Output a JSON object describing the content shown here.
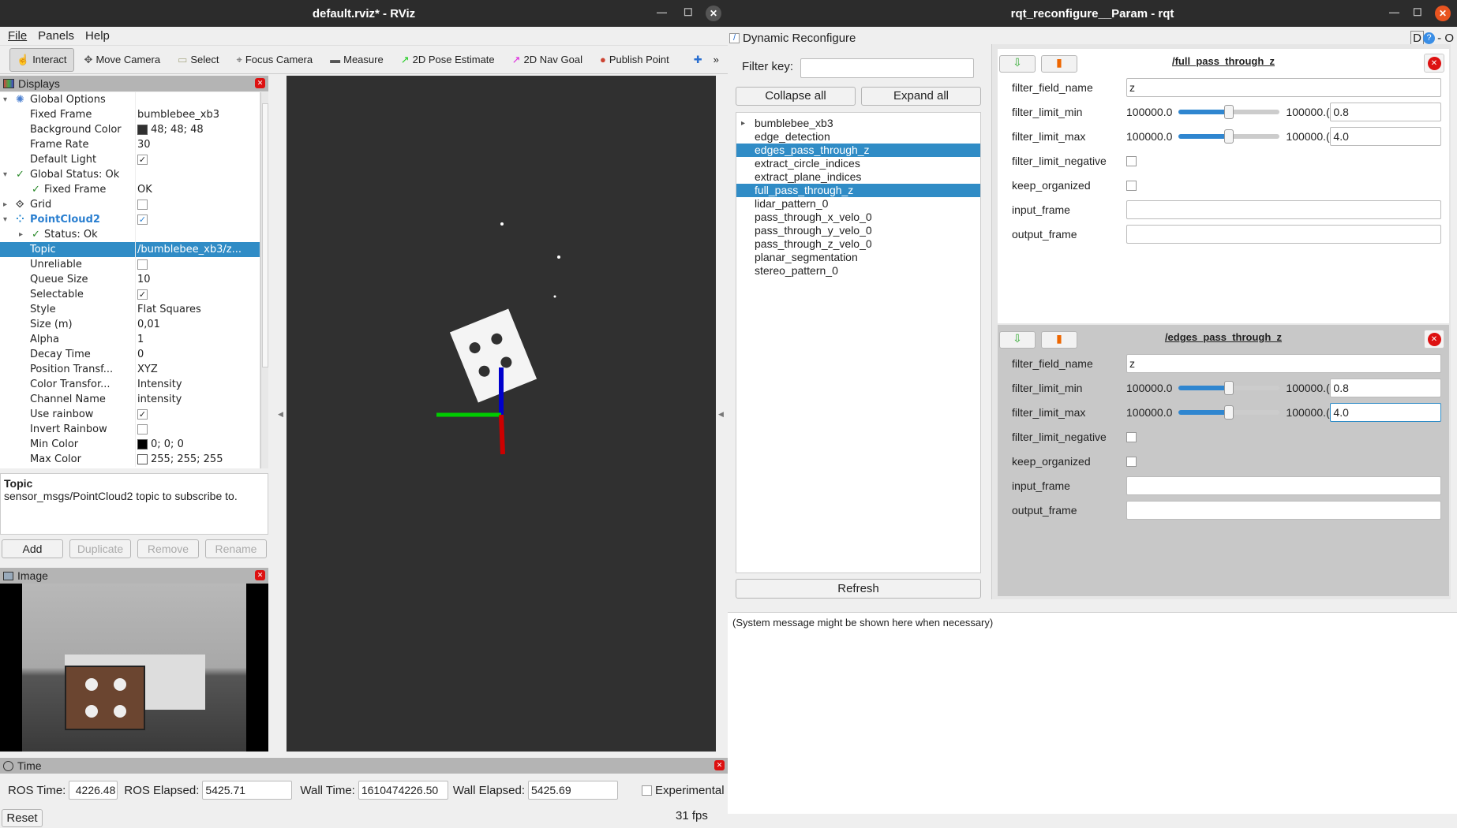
{
  "rviz": {
    "title": "default.rviz* - RViz",
    "menu": [
      "File",
      "Panels",
      "Help"
    ],
    "tools": [
      {
        "label": "Interact",
        "icon": "hand-icon"
      },
      {
        "label": "Move Camera",
        "icon": "move-icon"
      },
      {
        "label": "Select",
        "icon": "select-icon"
      },
      {
        "label": "Focus Camera",
        "icon": "crosshair-icon"
      },
      {
        "label": "Measure",
        "icon": "ruler-icon"
      },
      {
        "label": "2D Pose Estimate",
        "icon": "green-arrow-icon"
      },
      {
        "label": "2D Nav Goal",
        "icon": "magenta-arrow-icon"
      },
      {
        "label": "Publish Point",
        "icon": "map-pin-icon"
      }
    ],
    "displays_title": "Displays",
    "tree": [
      {
        "label": "Global Options",
        "value": "",
        "indent": 1,
        "exp": "down",
        "icon": "gear-icon"
      },
      {
        "label": "Fixed Frame",
        "value": "bumblebee_xb3",
        "indent": 2
      },
      {
        "label": "Background Color",
        "value": "48; 48; 48",
        "indent": 2,
        "swatch": "#303030"
      },
      {
        "label": "Frame Rate",
        "value": "30",
        "indent": 2
      },
      {
        "label": "Default Light",
        "value": "",
        "indent": 2,
        "check": true
      },
      {
        "label": "Global Status: Ok",
        "value": "",
        "indent": 1,
        "exp": "down",
        "icon": "check-icon"
      },
      {
        "label": "Fixed Frame",
        "value": "OK",
        "indent": 2,
        "icon": "check-icon"
      },
      {
        "label": "Grid",
        "value": "",
        "indent": 1,
        "exp": "right",
        "icon": "grid-icon",
        "check": false
      },
      {
        "label": "PointCloud2",
        "value": "",
        "indent": 1,
        "exp": "down",
        "icon": "pointcloud-icon",
        "check": true,
        "blue": true
      },
      {
        "label": "Status: Ok",
        "value": "",
        "indent": 2,
        "exp": "right",
        "icon": "check-icon"
      },
      {
        "label": "Topic",
        "value": "/bumblebee_xb3/z...",
        "indent": 2,
        "sel": true
      },
      {
        "label": "Unreliable",
        "value": "",
        "indent": 2,
        "check": false
      },
      {
        "label": "Queue Size",
        "value": "10",
        "indent": 2
      },
      {
        "label": "Selectable",
        "value": "",
        "indent": 2,
        "check": true
      },
      {
        "label": "Style",
        "value": "Flat Squares",
        "indent": 2
      },
      {
        "label": "Size (m)",
        "value": "0,01",
        "indent": 2
      },
      {
        "label": "Alpha",
        "value": "1",
        "indent": 2
      },
      {
        "label": "Decay Time",
        "value": "0",
        "indent": 2
      },
      {
        "label": "Position Transf...",
        "value": "XYZ",
        "indent": 2
      },
      {
        "label": "Color Transfor...",
        "value": "Intensity",
        "indent": 2
      },
      {
        "label": "Channel Name",
        "value": "intensity",
        "indent": 2
      },
      {
        "label": "Use rainbow",
        "value": "",
        "indent": 2,
        "check": true
      },
      {
        "label": "Invert Rainbow",
        "value": "",
        "indent": 2,
        "check": false
      },
      {
        "label": "Min Color",
        "value": "0; 0; 0",
        "indent": 2,
        "swatch": "#000000"
      },
      {
        "label": "Max Color",
        "value": "255; 255; 255",
        "indent": 2,
        "swatch": "#ffffff"
      }
    ],
    "desc_title": "Topic",
    "desc_text": "sensor_msgs/PointCloud2 topic to subscribe to.",
    "buttons": {
      "add": "Add",
      "duplicate": "Duplicate",
      "remove": "Remove",
      "rename": "Rename"
    },
    "image_title": "Image",
    "time": {
      "title": "Time",
      "ros_time_label": "ROS Time:",
      "ros_time": "4226.48",
      "ros_elapsed_label": "ROS Elapsed:",
      "ros_elapsed": "5425.71",
      "wall_time_label": "Wall Time:",
      "wall_time": "1610474226.50",
      "wall_elapsed_label": "Wall Elapsed:",
      "wall_elapsed": "5425.69",
      "experimental": "Experimental",
      "reset": "Reset",
      "fps": "31 fps"
    },
    "background_color": "#303030"
  },
  "rqt": {
    "title": "rqt_reconfigure__Param - rqt",
    "plugin_title": "Dynamic Reconfigure",
    "header_right": "D",
    "filter_label": "Filter key:",
    "filter_value": "",
    "collapse": "Collapse all",
    "expand": "Expand all",
    "nodes": [
      {
        "label": "bumblebee_xb3",
        "exp": true
      },
      {
        "label": "edge_detection"
      },
      {
        "label": "edges_pass_through_z",
        "sel": true
      },
      {
        "label": "extract_circle_indices"
      },
      {
        "label": "extract_plane_indices"
      },
      {
        "label": "full_pass_through_z",
        "sel": true
      },
      {
        "label": "lidar_pattern_0"
      },
      {
        "label": "pass_through_x_velo_0"
      },
      {
        "label": "pass_through_y_velo_0"
      },
      {
        "label": "pass_through_z_velo_0"
      },
      {
        "label": "planar_segmentation"
      },
      {
        "label": "stereo_pattern_0"
      }
    ],
    "refresh": "Refresh",
    "panels": [
      {
        "title": "/full_pass_through_z",
        "field_name": "z",
        "min_lo": "100000.0",
        "min_hi": "100000.(",
        "min_val": "0.8",
        "min_frac": 0.5,
        "max_lo": "100000.0",
        "max_hi": "100000.(",
        "max_val": "4.0",
        "max_frac": 0.5,
        "labels": [
          "filter_field_name",
          "filter_limit_min",
          "filter_limit_max",
          "filter_limit_negative",
          "keep_organized",
          "input_frame",
          "output_frame"
        ],
        "input_frame": "",
        "output_frame": ""
      },
      {
        "title": "/edges_pass_through_z",
        "field_name": "z",
        "min_lo": "100000.0",
        "min_hi": "100000.(",
        "min_val": "0.8",
        "min_frac": 0.5,
        "max_lo": "100000.0",
        "max_hi": "100000.(",
        "max_val": "4.0",
        "max_frac": 0.5,
        "labels": [
          "filter_field_name",
          "filter_limit_min",
          "filter_limit_max",
          "filter_limit_negative",
          "keep_organized",
          "input_frame",
          "output_frame"
        ],
        "input_frame": "",
        "output_frame": ""
      }
    ],
    "system_message": "(System message might be shown here when necessary)",
    "selection_color": "#308cc6"
  }
}
